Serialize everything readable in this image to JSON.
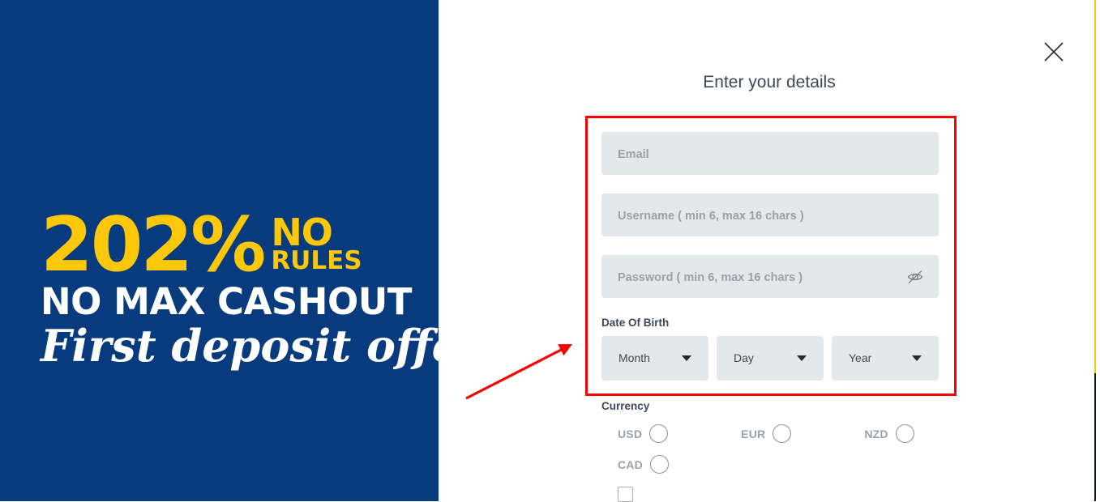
{
  "promo": {
    "percent": "202%",
    "no": "NO",
    "rules": "RULES",
    "cashout": "NO MAX CASHOUT",
    "first_deposit": "First deposit offer",
    "background_color": "#073b7d",
    "accent_color": "#fdc80a",
    "text_color": "#ffffff"
  },
  "dialog": {
    "title": "Enter your details",
    "close_icon": "close-icon"
  },
  "form": {
    "email": {
      "placeholder": "Email",
      "value": ""
    },
    "username": {
      "placeholder": "Username ( min 6, max 16 chars )",
      "value": ""
    },
    "password": {
      "placeholder": "Password ( min 6, max 16 chars )",
      "value": "",
      "toggle_icon": "eye-off-icon"
    },
    "date_of_birth": {
      "label": "Date Of Birth",
      "month": {
        "selected": "Month",
        "caret_icon": "chevron-down-icon"
      },
      "day": {
        "selected": "Day",
        "caret_icon": "chevron-down-icon"
      },
      "year": {
        "selected": "Year",
        "caret_icon": "chevron-down-icon"
      }
    },
    "currency": {
      "label": "Currency",
      "options": [
        {
          "code": "USD",
          "selected": false
        },
        {
          "code": "EUR",
          "selected": false
        },
        {
          "code": "NZD",
          "selected": false
        },
        {
          "code": "CAD",
          "selected": false
        }
      ]
    },
    "field_background_color": "#e3e8ea",
    "placeholder_color": "#9aa1a8"
  },
  "annotation": {
    "color": "#fc0000",
    "highlight_target": "date-of-birth-and-fields",
    "arrow_points_to": "Date Of Birth"
  },
  "edge_rule": {
    "top_color": "#fdc80a",
    "bottom_color": "#0d1a26"
  }
}
